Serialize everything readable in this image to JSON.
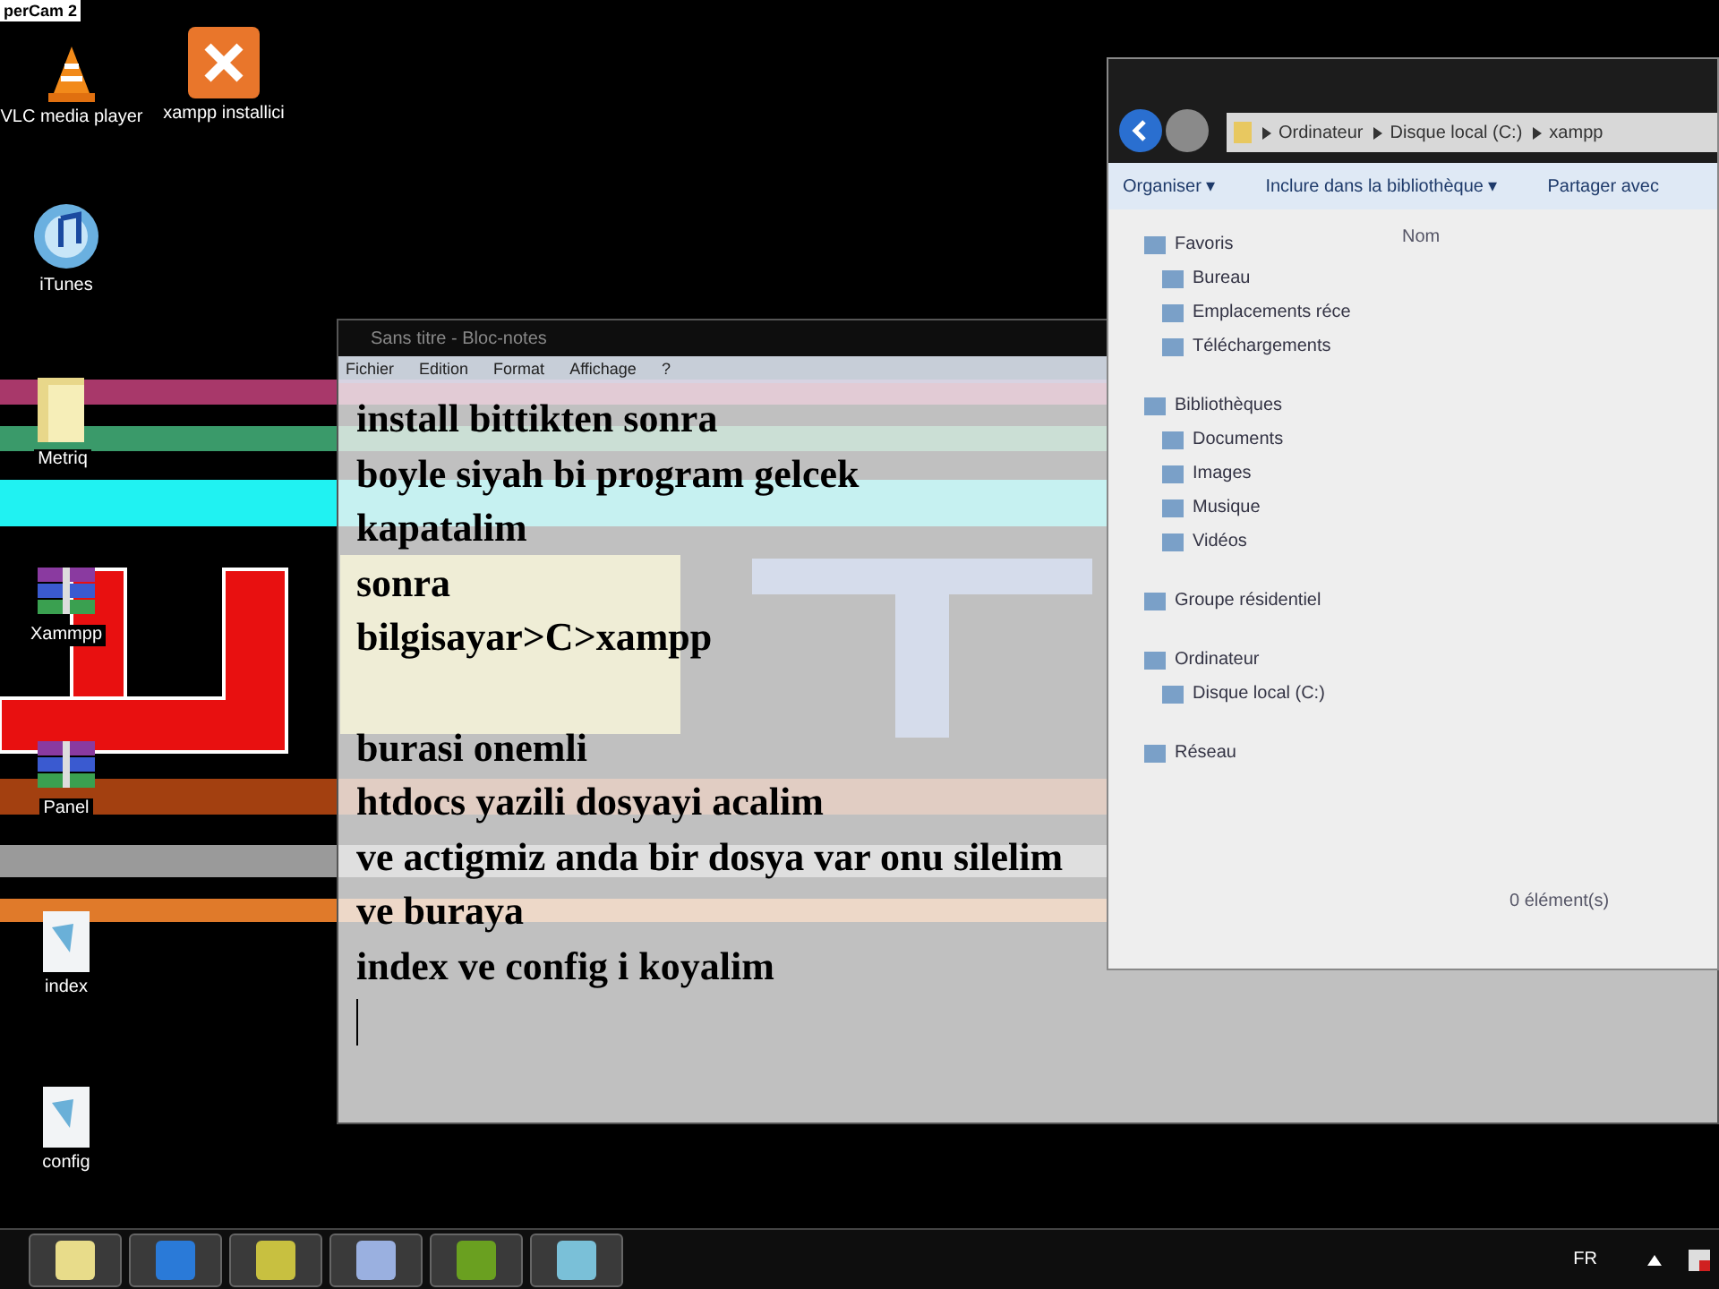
{
  "background_window": {
    "title": "perCam 2"
  },
  "desktop_icons": [
    {
      "label": "VLC media player"
    },
    {
      "label": "xampp installici"
    },
    {
      "label": "iTunes"
    },
    {
      "label": "Metriq"
    },
    {
      "label": "Xammpp"
    },
    {
      "label": "Panel"
    },
    {
      "label": "index"
    },
    {
      "label": "config"
    }
  ],
  "explorer": {
    "breadcrumb": [
      "Ordinateur",
      "Disque local (C:)",
      "xampp"
    ],
    "toolbar": [
      "Organiser ▾",
      "Inclure dans la bibliothèque ▾",
      "Partager avec"
    ],
    "column_header": "Nom",
    "nav_groups": [
      {
        "label": "Favoris",
        "children": [
          {
            "label": "Bureau"
          },
          {
            "label": "Emplacements réce"
          },
          {
            "label": "Téléchargements"
          }
        ]
      },
      {
        "label": "Bibliothèques",
        "children": [
          {
            "label": "Documents"
          },
          {
            "label": "Images"
          },
          {
            "label": "Musique"
          },
          {
            "label": "Vidéos"
          }
        ]
      },
      {
        "label": "Groupe résidentiel"
      },
      {
        "label": "Ordinateur",
        "children": [
          {
            "label": "Disque local (C:)"
          }
        ]
      },
      {
        "label": "Réseau"
      }
    ],
    "status": "0 élément(s)"
  },
  "notepad": {
    "title": "Sans titre - Bloc-notes",
    "menu": [
      "Fichier",
      "Edition",
      "Format",
      "Affichage",
      "?"
    ],
    "paragraphs": [
      [
        "install bittikten sonra",
        "boyle siyah bi program gelcek",
        "kapatalim",
        "sonra",
        "bilgisayar>C>xampp"
      ],
      [
        "burasi onemli",
        "htdocs yazili dosyayi acalim",
        "ve actigmiz anda bir dosya var onu silelim",
        "ve buraya",
        "index ve config i koyalim"
      ]
    ]
  },
  "taskbar": {
    "language": "FR"
  }
}
